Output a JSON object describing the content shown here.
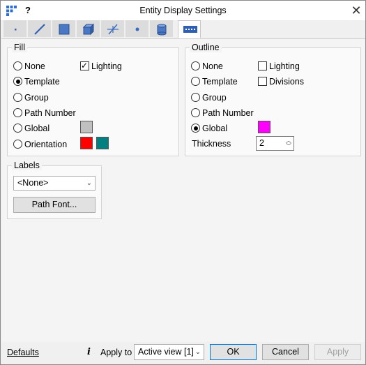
{
  "titlebar": {
    "help": "?",
    "title": "Entity Display Settings",
    "close": "✕"
  },
  "tabs": [
    {
      "icon": "point-icon"
    },
    {
      "icon": "line-icon"
    },
    {
      "icon": "surface-icon"
    },
    {
      "icon": "solid-icon"
    },
    {
      "icon": "mesh-icon"
    },
    {
      "icon": "node-icon"
    },
    {
      "icon": "cylinder-icon"
    },
    {
      "icon": "path-icon",
      "active": true
    }
  ],
  "fill": {
    "legend": "Fill",
    "options": [
      "None",
      "Template",
      "Group",
      "Path Number",
      "Global",
      "Orientation"
    ],
    "selected": "Template",
    "lighting_label": "Lighting",
    "lighting_checked": true,
    "global_color": "#c0c0c0",
    "orientation_colors": [
      "#ff0000",
      "#008080"
    ]
  },
  "outline": {
    "legend": "Outline",
    "options": [
      "None",
      "Template",
      "Group",
      "Path Number",
      "Global"
    ],
    "selected": "Global",
    "lighting_label": "Lighting",
    "divisions_label": "Divisions",
    "global_color": "#ff00ff",
    "thickness_label": "Thickness",
    "thickness_value": "2"
  },
  "labels": {
    "legend": "Labels",
    "combo_value": "<None>",
    "path_font_button": "Path Font..."
  },
  "footer": {
    "defaults": "Defaults",
    "info_icon": "i",
    "apply_to_label": "Apply to",
    "apply_to_value": "Active view [1]",
    "ok": "OK",
    "cancel": "Cancel",
    "apply": "Apply"
  }
}
